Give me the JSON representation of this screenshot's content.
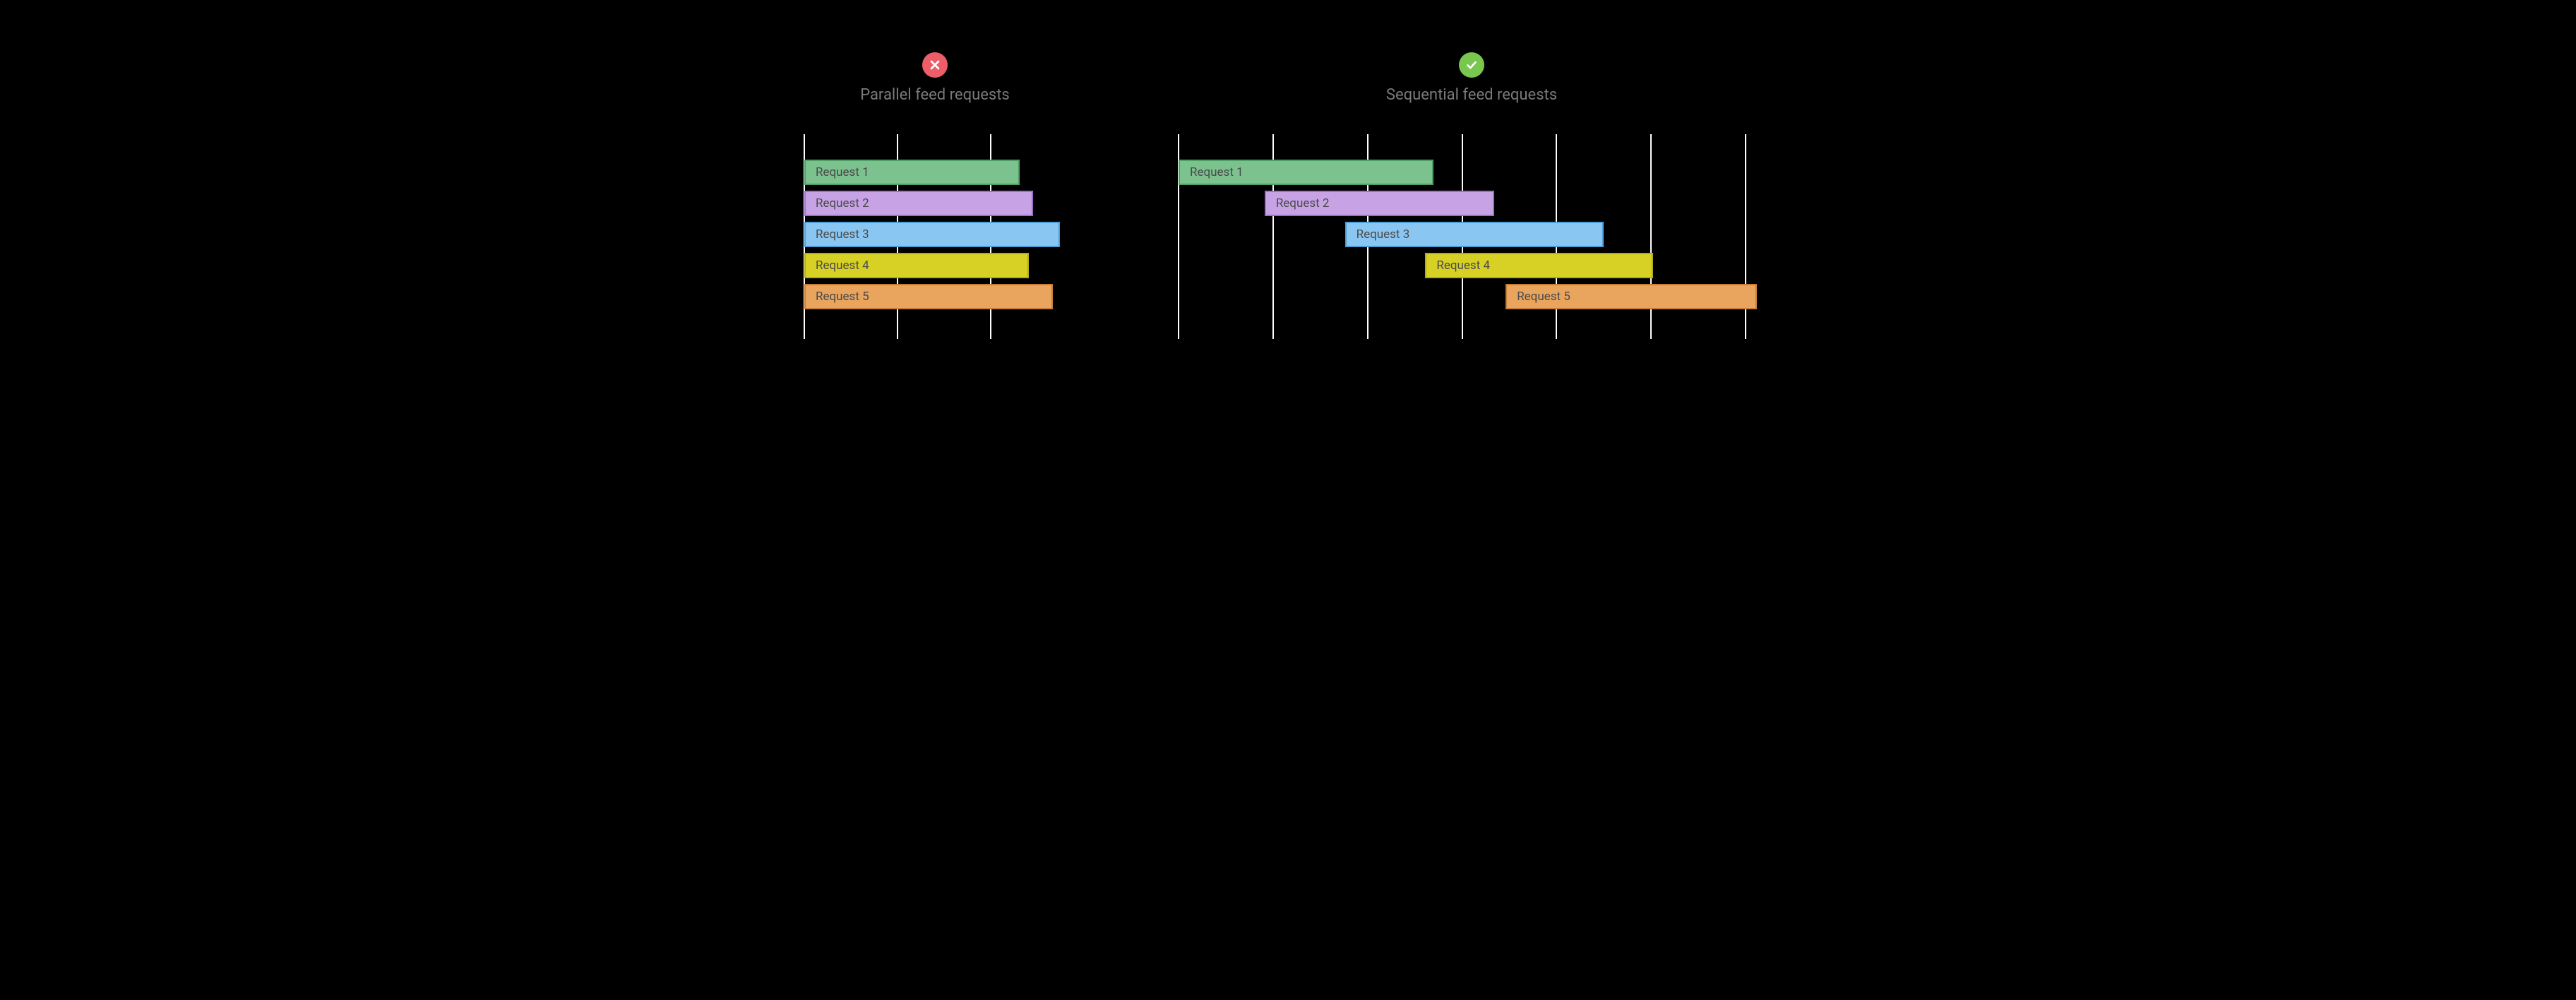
{
  "chart_data": [
    {
      "type": "bar",
      "title": "Parallel feed requests",
      "status": "bad",
      "x_range": [
        0,
        2.8
      ],
      "gridlines": [
        0,
        1,
        2,
        2.8
      ],
      "icon": "cross",
      "series": [
        {
          "name": "Request 1",
          "start": 0,
          "end": 2.31,
          "color": "green"
        },
        {
          "name": "Request 2",
          "start": 0,
          "end": 2.45,
          "color": "purple"
        },
        {
          "name": "Request 3",
          "start": 0,
          "end": 2.74,
          "color": "blue"
        },
        {
          "name": "Request 4",
          "start": 0,
          "end": 2.41,
          "color": "yellow"
        },
        {
          "name": "Request 5",
          "start": 0,
          "end": 2.66,
          "color": "orange"
        }
      ]
    },
    {
      "type": "bar",
      "title": "Sequential feed requests",
      "status": "good",
      "x_range": [
        0,
        6.2
      ],
      "gridlines": [
        0,
        1,
        2,
        3,
        4,
        5,
        6,
        6.2
      ],
      "icon": "check",
      "series": [
        {
          "name": "Request 1",
          "start": 0.0,
          "end": 2.7,
          "color": "green"
        },
        {
          "name": "Request 2",
          "start": 0.91,
          "end": 3.34,
          "color": "purple"
        },
        {
          "name": "Request 3",
          "start": 1.76,
          "end": 4.5,
          "color": "blue"
        },
        {
          "name": "Request 4",
          "start": 2.61,
          "end": 5.02,
          "color": "yellow"
        },
        {
          "name": "Request 5",
          "start": 3.46,
          "end": 6.12,
          "color": "orange"
        }
      ]
    }
  ]
}
